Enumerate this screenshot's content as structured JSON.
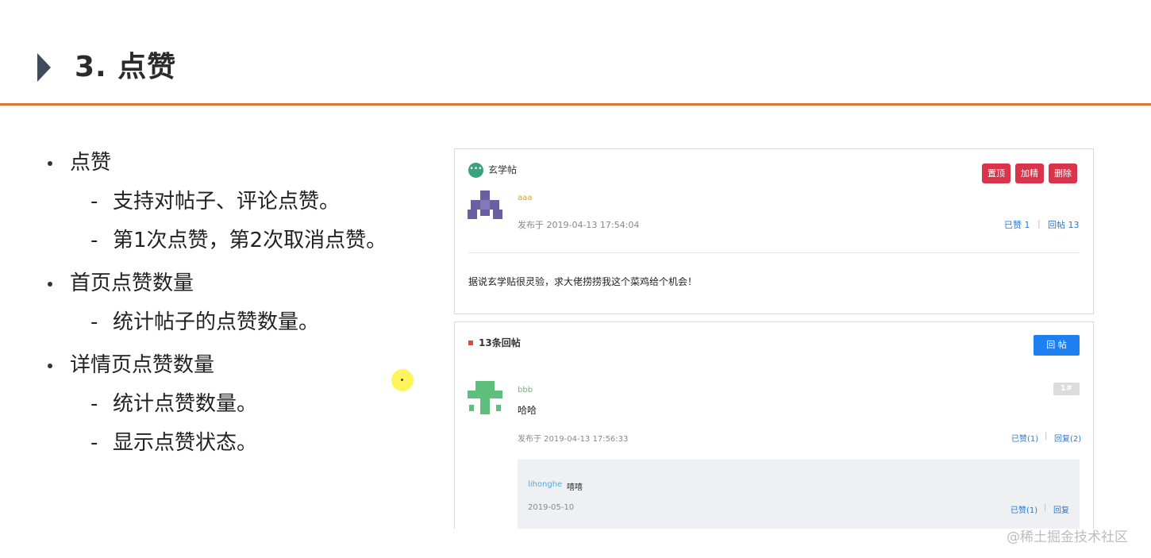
{
  "slide": {
    "title": "3. 点赞",
    "watermark": "@稀土掘金技术社区"
  },
  "bullets": [
    {
      "text": "点赞",
      "children": [
        "支持对帖子、评论点赞。",
        "第1次点赞，第2次取消点赞。"
      ]
    },
    {
      "text": "首页点赞数量",
      "children": [
        "统计帖子的点赞数量。"
      ]
    },
    {
      "text": "详情页点赞数量",
      "children": [
        "统计点赞数量。",
        "显示点赞状态。"
      ]
    }
  ],
  "post": {
    "tag": "玄学帖",
    "buttons": {
      "top": "置顶",
      "featured": "加精",
      "delete": "删除"
    },
    "author": "aaa",
    "published": "发布于 2019-04-13 17:54:04",
    "likes": "已赞 1",
    "separator": "|",
    "replies": "回帖 13",
    "content": "据说玄学贴很灵验，求大佬捞捞我这个菜鸡给个机会！"
  },
  "comments": {
    "count_label": "13条回帖",
    "reply_button": "回 帖",
    "items": [
      {
        "author": "bbb",
        "floor": "1#",
        "content": "哈哈",
        "published": "发布于 2019-04-13 17:56:33",
        "likes": "已赞(1)",
        "separator": "|",
        "reply": "回复(2)",
        "sub_reply": {
          "author": "lihonghe",
          "content": "嘻嘻",
          "date": "2019-05-10",
          "likes": "已赞(1)",
          "separator": "|",
          "reply": "回复"
        }
      }
    ]
  },
  "colors": {
    "accent_rule": "#d97b2b",
    "danger": "#d9344a",
    "primary": "#1e7ff0",
    "link": "#2a79d0"
  }
}
